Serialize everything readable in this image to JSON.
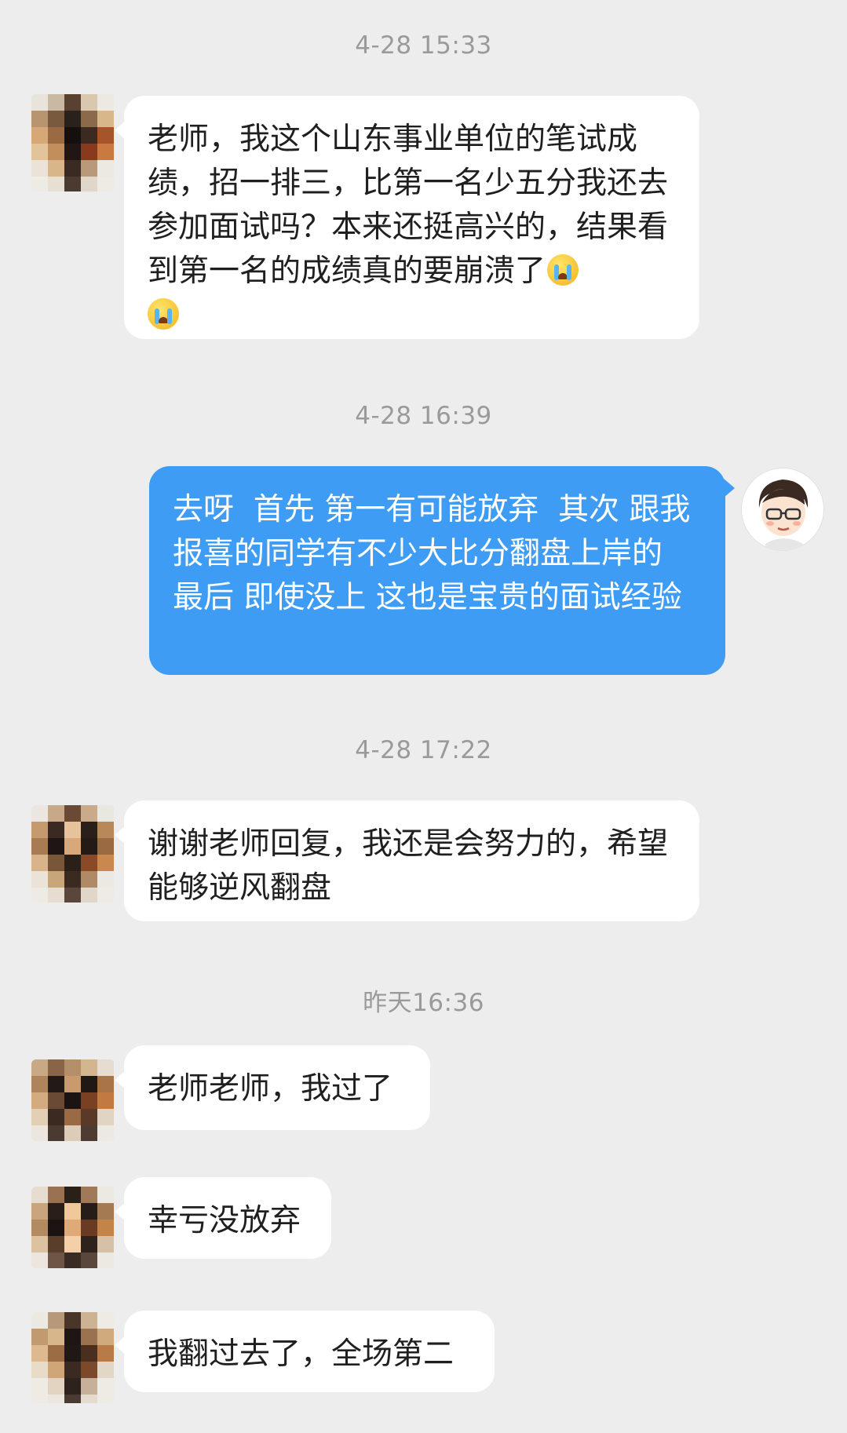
{
  "timestamps": [
    "4-28 15:33",
    "4-28 16:39",
    "4-28 17:22",
    "昨天16:36"
  ],
  "messages": [
    {
      "text": "老师，我这个山东事业单位的笔试成绩，招一排三，比第一名少五分我还去参加面试吗？本来还挺高兴的，结果看到第一名的成绩真的要崩溃了",
      "emoji": "crying-face-emoji"
    },
    {
      "text": "去呀  首先 第一有可能放弃  其次 跟我报喜的同学有不少大比分翻盘上岸的 最后 即使没上 这也是宝贵的面试经验"
    },
    {
      "text": "谢谢老师回复，我还是会努力的，希望能够逆风翻盘"
    },
    {
      "text": "老师老师，我过了"
    },
    {
      "text": "幸亏没放弃"
    },
    {
      "text": "我翻过去了，全场第二"
    }
  ],
  "colors": {
    "background": "#ededed",
    "incoming_bubble": "#ffffff",
    "outgoing_bubble": "#3f9cf5",
    "timestamp": "#9a9a9a"
  }
}
